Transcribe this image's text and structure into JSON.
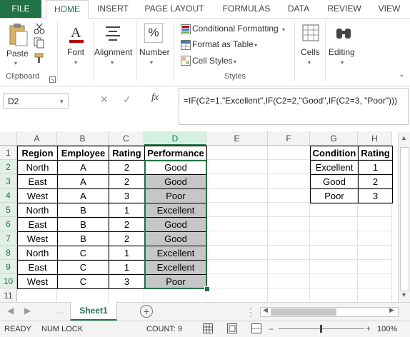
{
  "ribbon_tabs": [
    "FILE",
    "HOME",
    "INSERT",
    "PAGE LAYOUT",
    "FORMULAS",
    "DATA",
    "REVIEW",
    "VIEW"
  ],
  "ribbon": {
    "paste": "Paste",
    "font": "Font",
    "alignment": "Alignment",
    "number": "Number",
    "percent_symbol": "%",
    "conditional_formatting": "Conditional Formatting",
    "format_as_table": "Format as Table",
    "cell_styles": "Cell Styles",
    "cells": "Cells",
    "editing": "Editing",
    "clipboard_group": "Clipboard",
    "styles_group": "Styles"
  },
  "formula_bar": {
    "name_box": "D2",
    "fx": "fx",
    "cancel": "✕",
    "enter": "✓",
    "formula": "=IF(C2=1,\"Excellent\",IF(C2=2,\"Good\",IF(C2=3, \"Poor\")))"
  },
  "columns": [
    "A",
    "B",
    "C",
    "D",
    "E",
    "F",
    "G",
    "H"
  ],
  "rows": [
    "1",
    "2",
    "3",
    "4",
    "5",
    "6",
    "7",
    "8",
    "9",
    "10",
    "11"
  ],
  "table_main": {
    "headers": [
      "Region",
      "Employee",
      "Rating",
      "Performance"
    ],
    "rows": [
      [
        "North",
        "A",
        "2",
        "Good"
      ],
      [
        "East",
        "A",
        "2",
        "Good"
      ],
      [
        "West",
        "A",
        "3",
        "Poor"
      ],
      [
        "North",
        "B",
        "1",
        "Excellent"
      ],
      [
        "East",
        "B",
        "2",
        "Good"
      ],
      [
        "West",
        "B",
        "2",
        "Good"
      ],
      [
        "North",
        "C",
        "1",
        "Excellent"
      ],
      [
        "East",
        "C",
        "1",
        "Excellent"
      ],
      [
        "West",
        "C",
        "3",
        "Poor"
      ]
    ]
  },
  "table_lookup": {
    "headers": [
      "Condition",
      "Rating"
    ],
    "rows": [
      [
        "Excellent",
        "1"
      ],
      [
        "Good",
        "2"
      ],
      [
        "Poor",
        "3"
      ]
    ]
  },
  "sheet_tabs": [
    "Sheet1"
  ],
  "status": {
    "ready": "READY",
    "num_lock": "NUM LOCK",
    "count": "COUNT: 9",
    "zoom": "100%"
  },
  "colors": {
    "accent": "#217346",
    "selection_fill": "#c6c6c6"
  }
}
